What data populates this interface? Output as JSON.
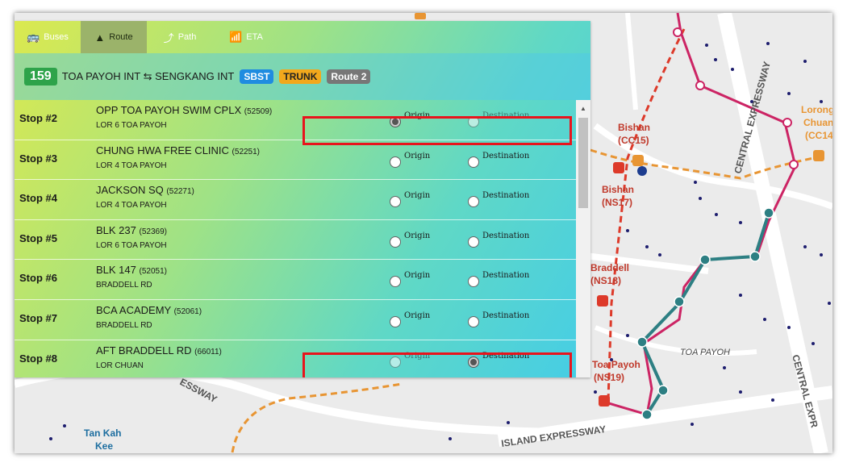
{
  "tabs": [
    {
      "label": "Buses",
      "icon": "bus-icon"
    },
    {
      "label": "Route",
      "icon": "road-icon"
    },
    {
      "label": "Path",
      "icon": "path-icon"
    },
    {
      "label": "ETA",
      "icon": "signal-icon"
    }
  ],
  "route": {
    "service": "159",
    "name": "TOA PAYOH INT ⇆ SENGKANG INT",
    "operator": "SBST",
    "category": "TRUNK",
    "direction": "Route 2"
  },
  "option_labels": {
    "origin": "Origin",
    "destination": "Destination"
  },
  "stops": [
    {
      "number": "Stop #2",
      "name": "OPP TOA PAYOH SWIM CPLX",
      "code": "(52509)",
      "road": "LOR 6 TOA PAYOH",
      "origin": "selected",
      "destination": "disabled"
    },
    {
      "number": "Stop #3",
      "name": "CHUNG HWA FREE CLINIC",
      "code": "(52251)",
      "road": "LOR 4 TOA PAYOH",
      "origin": "normal",
      "destination": "normal"
    },
    {
      "number": "Stop #4",
      "name": "JACKSON SQ",
      "code": "(52271)",
      "road": "LOR 4 TOA PAYOH",
      "origin": "normal",
      "destination": "normal"
    },
    {
      "number": "Stop #5",
      "name": "BLK 237",
      "code": "(52369)",
      "road": "LOR 6 TOA PAYOH",
      "origin": "normal",
      "destination": "normal"
    },
    {
      "number": "Stop #6",
      "name": "BLK 147",
      "code": "(52051)",
      "road": "BRADDELL RD",
      "origin": "normal",
      "destination": "normal"
    },
    {
      "number": "Stop #7",
      "name": "BCA ACADEMY",
      "code": "(52061)",
      "road": "BRADDELL RD",
      "origin": "normal",
      "destination": "normal"
    },
    {
      "number": "Stop #8",
      "name": "AFT BRADDELL RD",
      "code": "(66011)",
      "road": "LOR CHUAN",
      "origin": "disabled",
      "destination": "selected"
    }
  ],
  "map": {
    "labels": {
      "bishan_cc": "Bishan",
      "bishan_cc_code": "(CC15)",
      "bishan_ns": "Bishan",
      "bishan_ns_code": "(NS17)",
      "braddell": "Braddell",
      "braddell_code": "(NS18)",
      "toa_payoh_stn": "Toa Payoh",
      "toa_payoh_code": "(NS19)",
      "toa_payoh_area": "TOA PAYOH",
      "lorong_chuan": "Lorong",
      "lorong_chuan2": "Chuan",
      "lorong_chuan_code": "(CC14)",
      "cte1": "CENTRAL EXPRESSWAY",
      "cte2": "CENTRAL EXPR",
      "pie": "ISLAND EXPRESSWAY",
      "pie_left": "ESSWAY",
      "tan_kah_kee": "Tan Kah",
      "tan_kah_kee2": "Kee"
    },
    "colors": {
      "route_pink": "#cc2464",
      "route_teal": "#2d7f83",
      "mrt_red": "#dd3a2a",
      "ccl_orange": "#e89533",
      "stop_dot": "#1d1d6e"
    }
  }
}
